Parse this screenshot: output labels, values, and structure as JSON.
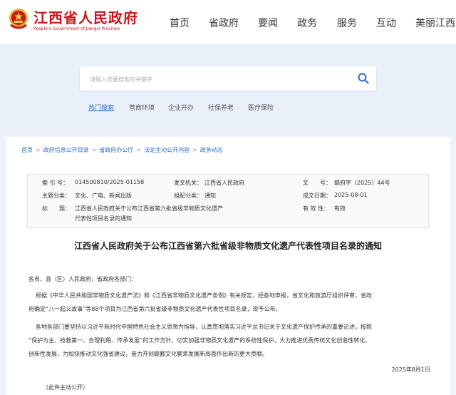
{
  "header": {
    "logo_cn": "江西省人民政府",
    "logo_en": "People's Government of Jiangxi Province",
    "nav": [
      "首页",
      "省政府",
      "要闻",
      "政务",
      "服务",
      "互动",
      "美丽江西"
    ]
  },
  "search": {
    "placeholder": "请输入您要搜索的关键字"
  },
  "hot": {
    "label": "热门搜索",
    "items": [
      "营商环境",
      "企业开办",
      "社保养老",
      "医疗保险"
    ]
  },
  "breadcrumb": [
    "首页",
    "政府信息公开目录",
    "省政府办公厅",
    "法定主动公开内容",
    "政务动态"
  ],
  "meta": {
    "index_k": "索 引 号：",
    "index_v": "014500810/2025-01158",
    "issuer_k": "发文机关：",
    "issuer_v": "江西省人民政府",
    "docno_k": "文　　号：",
    "docno_v": "赣府字〔2025〕44号",
    "topic_k": "主题分类：",
    "topic_v": "文化、广电、新闻出版",
    "form_k": "组配分类：",
    "form_v": "通知",
    "date_k": "成文日期：",
    "date_v": "2025-08-01",
    "title_k": "标　　题：",
    "title_v1": "江西省人民政府关于公布江西省第六批省级非物质文化遗产",
    "title_v2": "代表性项目名录的通知",
    "valid_k": "有 效 性：",
    "valid_v": "有效"
  },
  "article": {
    "title": "江西省人民政府关于公布江西省第六批省级非物质文化遗产代表性项目名录的通知",
    "greeting": "各市、县（区）人民政府，省政府各部门：",
    "p1a": "根据《中华人民共和国非物质文化遗产法》和《江西省非物质文化遗产条例》有关规定，经各地申报，省文化和旅游厅组织评审，省政",
    "p1b": "府确定“八一起义故事”等88个项目为江西省第六批省级非物质文化遗产代表性项目名录，现予公布。",
    "p2a": "各地各部门要坚持以习近平新时代中国特色社会主义思想为指导，认真贯彻落实习近平总书记关于文化遗产保护传承的重要论述，按照",
    "p2b": "“保护为主、抢救第一、合理利用、传承发展”的工作方针，切实加强非物质文化遗产的系统性保护，大力推进优秀传统文化创造性转化、",
    "p2c": "创新性发展，为加快推动文化强省建设，奋力开创赣鄱文化繁荣发展新局面作出新的更大贡献。",
    "date": "2025年8月1日",
    "note": "（此件主动公开）"
  }
}
